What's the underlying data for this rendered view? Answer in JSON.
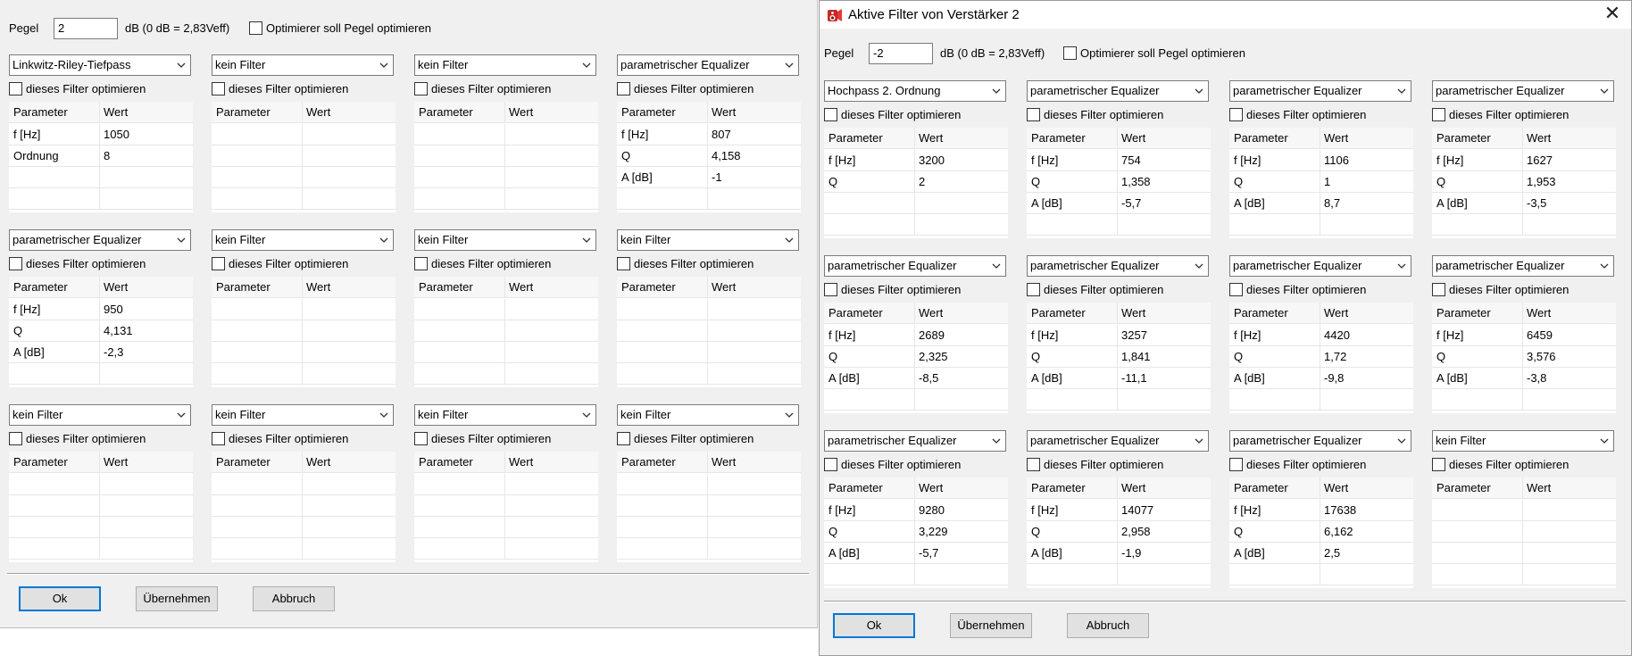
{
  "dialog1": {
    "pegel_label": "Pegel",
    "pegel_value": "2",
    "unit_label": "dB (0 dB = 2,83Veff)",
    "optimize_pegel_label": "Optimierer soll Pegel optimieren",
    "filters": [
      {
        "type": "Linkwitz-Riley-Tiefpass",
        "optimize_label": "dieses Filter optimieren",
        "header": [
          "Parameter",
          "Wert"
        ],
        "rows": [
          [
            "f [Hz]",
            "1050"
          ],
          [
            "Ordnung",
            "8"
          ],
          [
            "",
            ""
          ],
          [
            "",
            ""
          ]
        ]
      },
      {
        "type": "kein Filter",
        "optimize_label": "dieses Filter optimieren",
        "header": [
          "Parameter",
          "Wert"
        ],
        "rows": [
          [
            "",
            ""
          ],
          [
            "",
            ""
          ],
          [
            "",
            ""
          ],
          [
            "",
            ""
          ]
        ]
      },
      {
        "type": "kein Filter",
        "optimize_label": "dieses Filter optimieren",
        "header": [
          "Parameter",
          "Wert"
        ],
        "rows": [
          [
            "",
            ""
          ],
          [
            "",
            ""
          ],
          [
            "",
            ""
          ],
          [
            "",
            ""
          ]
        ]
      },
      {
        "type": "parametrischer Equalizer",
        "optimize_label": "dieses Filter optimieren",
        "header": [
          "Parameter",
          "Wert"
        ],
        "rows": [
          [
            "f [Hz]",
            "807"
          ],
          [
            "Q",
            "4,158"
          ],
          [
            "A [dB]",
            "-1"
          ],
          [
            "",
            ""
          ]
        ]
      },
      {
        "type": "parametrischer Equalizer",
        "optimize_label": "dieses Filter optimieren",
        "header": [
          "Parameter",
          "Wert"
        ],
        "rows": [
          [
            "f [Hz]",
            "950"
          ],
          [
            "Q",
            "4,131"
          ],
          [
            "A [dB]",
            "-2,3"
          ],
          [
            "",
            ""
          ]
        ]
      },
      {
        "type": "kein Filter",
        "optimize_label": "dieses Filter optimieren",
        "header": [
          "Parameter",
          "Wert"
        ],
        "rows": [
          [
            "",
            ""
          ],
          [
            "",
            ""
          ],
          [
            "",
            ""
          ],
          [
            "",
            ""
          ]
        ]
      },
      {
        "type": "kein Filter",
        "optimize_label": "dieses Filter optimieren",
        "header": [
          "Parameter",
          "Wert"
        ],
        "rows": [
          [
            "",
            ""
          ],
          [
            "",
            ""
          ],
          [
            "",
            ""
          ],
          [
            "",
            ""
          ]
        ]
      },
      {
        "type": "kein Filter",
        "optimize_label": "dieses Filter optimieren",
        "header": [
          "Parameter",
          "Wert"
        ],
        "rows": [
          [
            "",
            ""
          ],
          [
            "",
            ""
          ],
          [
            "",
            ""
          ],
          [
            "",
            ""
          ]
        ]
      },
      {
        "type": "kein Filter",
        "optimize_label": "dieses Filter optimieren",
        "header": [
          "Parameter",
          "Wert"
        ],
        "rows": [
          [
            "",
            ""
          ],
          [
            "",
            ""
          ],
          [
            "",
            ""
          ],
          [
            "",
            ""
          ]
        ]
      },
      {
        "type": "kein Filter",
        "optimize_label": "dieses Filter optimieren",
        "header": [
          "Parameter",
          "Wert"
        ],
        "rows": [
          [
            "",
            ""
          ],
          [
            "",
            ""
          ],
          [
            "",
            ""
          ],
          [
            "",
            ""
          ]
        ]
      },
      {
        "type": "kein Filter",
        "optimize_label": "dieses Filter optimieren",
        "header": [
          "Parameter",
          "Wert"
        ],
        "rows": [
          [
            "",
            ""
          ],
          [
            "",
            ""
          ],
          [
            "",
            ""
          ],
          [
            "",
            ""
          ]
        ]
      },
      {
        "type": "kein Filter",
        "optimize_label": "dieses Filter optimieren",
        "header": [
          "Parameter",
          "Wert"
        ],
        "rows": [
          [
            "",
            ""
          ],
          [
            "",
            ""
          ],
          [
            "",
            ""
          ],
          [
            "",
            ""
          ]
        ]
      }
    ],
    "buttons": {
      "ok": "Ok",
      "apply": "Übernehmen",
      "cancel": "Abbruch"
    }
  },
  "dialog2": {
    "title": "Aktive Filter von Verstärker 2",
    "pegel_label": "Pegel",
    "pegel_value": "-2",
    "unit_label": "dB (0 dB = 2,83Veff)",
    "optimize_pegel_label": "Optimierer soll Pegel optimieren",
    "filters": [
      {
        "type": "Hochpass 2. Ordnung",
        "optimize_label": "dieses Filter optimieren",
        "header": [
          "Parameter",
          "Wert"
        ],
        "rows": [
          [
            "f [Hz]",
            "3200"
          ],
          [
            "Q",
            "2"
          ],
          [
            "",
            ""
          ],
          [
            "",
            ""
          ]
        ]
      },
      {
        "type": "parametrischer Equalizer",
        "optimize_label": "dieses Filter optimieren",
        "header": [
          "Parameter",
          "Wert"
        ],
        "rows": [
          [
            "f [Hz]",
            "754"
          ],
          [
            "Q",
            "1,358"
          ],
          [
            "A [dB]",
            "-5,7"
          ],
          [
            "",
            ""
          ]
        ]
      },
      {
        "type": "parametrischer Equalizer",
        "optimize_label": "dieses Filter optimieren",
        "header": [
          "Parameter",
          "Wert"
        ],
        "rows": [
          [
            "f [Hz]",
            "1106"
          ],
          [
            "Q",
            "1"
          ],
          [
            "A [dB]",
            "8,7"
          ],
          [
            "",
            ""
          ]
        ]
      },
      {
        "type": "parametrischer Equalizer",
        "optimize_label": "dieses Filter optimieren",
        "header": [
          "Parameter",
          "Wert"
        ],
        "rows": [
          [
            "f [Hz]",
            "1627"
          ],
          [
            "Q",
            "1,953"
          ],
          [
            "A [dB]",
            "-3,5"
          ],
          [
            "",
            ""
          ]
        ]
      },
      {
        "type": "parametrischer Equalizer",
        "optimize_label": "dieses Filter optimieren",
        "header": [
          "Parameter",
          "Wert"
        ],
        "rows": [
          [
            "f [Hz]",
            "2689"
          ],
          [
            "Q",
            "2,325"
          ],
          [
            "A [dB]",
            "-8,5"
          ],
          [
            "",
            ""
          ]
        ]
      },
      {
        "type": "parametrischer Equalizer",
        "optimize_label": "dieses Filter optimieren",
        "header": [
          "Parameter",
          "Wert"
        ],
        "rows": [
          [
            "f [Hz]",
            "3257"
          ],
          [
            "Q",
            "1,841"
          ],
          [
            "A [dB]",
            "-11,1"
          ],
          [
            "",
            ""
          ]
        ]
      },
      {
        "type": "parametrischer Equalizer",
        "optimize_label": "dieses Filter optimieren",
        "header": [
          "Parameter",
          "Wert"
        ],
        "rows": [
          [
            "f [Hz]",
            "4420"
          ],
          [
            "Q",
            "1,72"
          ],
          [
            "A [dB]",
            "-9,8"
          ],
          [
            "",
            ""
          ]
        ]
      },
      {
        "type": "parametrischer Equalizer",
        "optimize_label": "dieses Filter optimieren",
        "header": [
          "Parameter",
          "Wert"
        ],
        "rows": [
          [
            "f [Hz]",
            "6459"
          ],
          [
            "Q",
            "3,576"
          ],
          [
            "A [dB]",
            "-3,8"
          ],
          [
            "",
            ""
          ]
        ]
      },
      {
        "type": "parametrischer Equalizer",
        "optimize_label": "dieses Filter optimieren",
        "header": [
          "Parameter",
          "Wert"
        ],
        "rows": [
          [
            "f [Hz]",
            "9280"
          ],
          [
            "Q",
            "3,229"
          ],
          [
            "A [dB]",
            "-5,7"
          ],
          [
            "",
            ""
          ]
        ]
      },
      {
        "type": "parametrischer Equalizer",
        "optimize_label": "dieses Filter optimieren",
        "header": [
          "Parameter",
          "Wert"
        ],
        "rows": [
          [
            "f [Hz]",
            "14077"
          ],
          [
            "Q",
            "2,958"
          ],
          [
            "A [dB]",
            "-1,9"
          ],
          [
            "",
            ""
          ]
        ]
      },
      {
        "type": "parametrischer Equalizer",
        "optimize_label": "dieses Filter optimieren",
        "header": [
          "Parameter",
          "Wert"
        ],
        "rows": [
          [
            "f [Hz]",
            "17638"
          ],
          [
            "Q",
            "6,162"
          ],
          [
            "A [dB]",
            "2,5"
          ],
          [
            "",
            ""
          ]
        ]
      },
      {
        "type": "kein Filter",
        "optimize_label": "dieses Filter optimieren",
        "header": [
          "Parameter",
          "Wert"
        ],
        "rows": [
          [
            "",
            ""
          ],
          [
            "",
            ""
          ],
          [
            "",
            ""
          ],
          [
            "",
            ""
          ]
        ]
      }
    ],
    "buttons": {
      "ok": "Ok",
      "apply": "Übernehmen",
      "cancel": "Abbruch"
    }
  }
}
